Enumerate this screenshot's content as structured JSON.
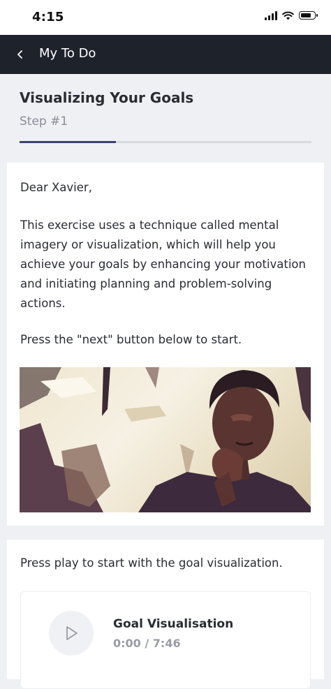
{
  "status_bar": {
    "time": "4:15"
  },
  "nav": {
    "back_icon": "chevron-left-icon",
    "title": "My To Do"
  },
  "header": {
    "title": "Visualizing Your Goals",
    "step": "Step #1",
    "progress_fraction": 0.33
  },
  "message": {
    "greeting": "Dear Xavier,",
    "body": "This exercise uses a technique called mental imagery or visualization, which will help you achieve your goals by enhancing your motivation and initiating planning and problem-solving actions.",
    "instruction": "Press the \"next\" button below to start."
  },
  "audio_section": {
    "prompt": "Press play to start with the goal visualization.",
    "track_title": "Goal Visualisation",
    "time": "0:00 / 7:46",
    "play_icon": "play-icon"
  }
}
